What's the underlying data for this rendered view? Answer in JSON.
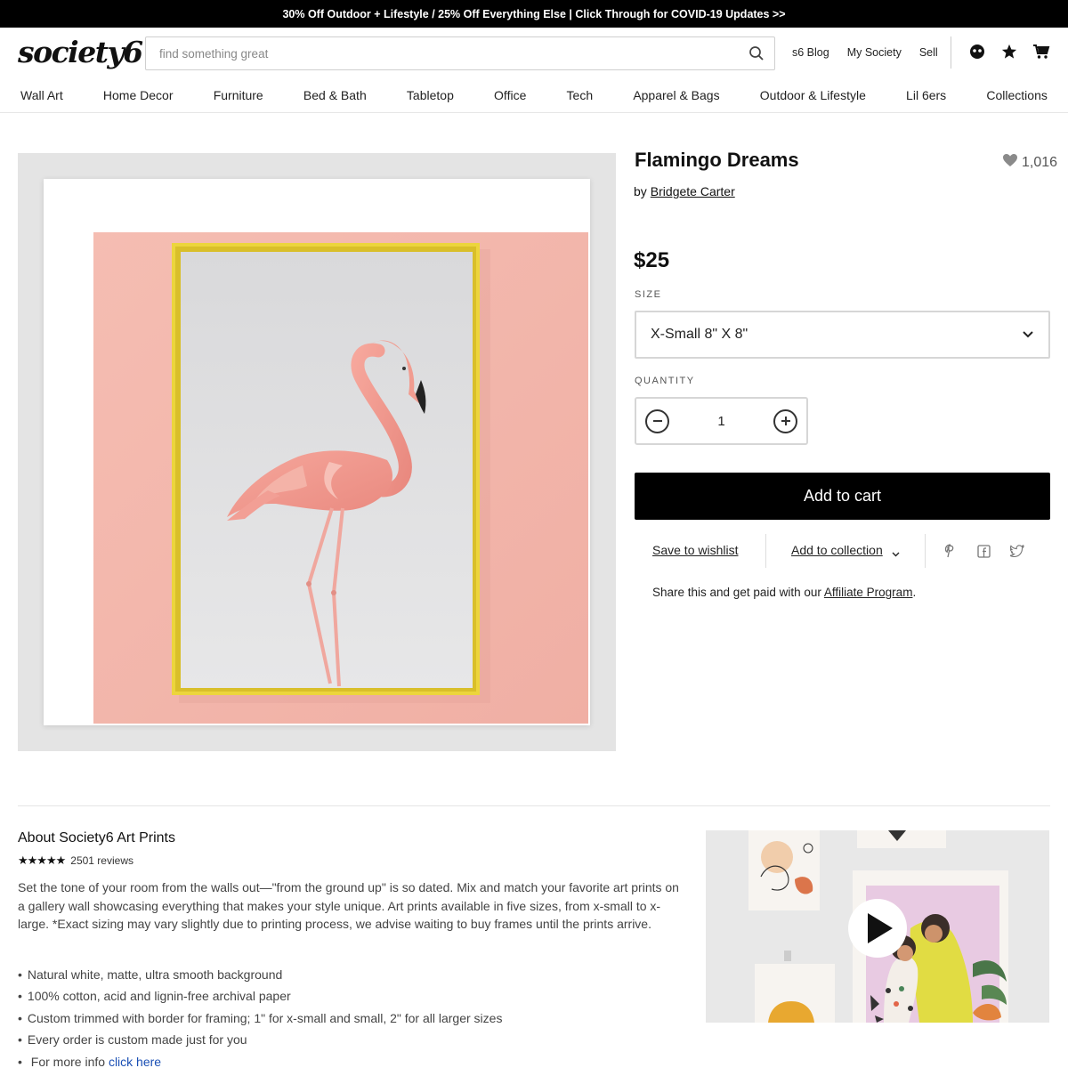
{
  "promo_banner": "30% Off Outdoor + Lifestyle / 25% Off Everything Else | Click Through for COVID-19 Updates >>",
  "header": {
    "logo": "society6",
    "search_placeholder": "find something great",
    "links": [
      "s6 Blog",
      "My Society",
      "Sell"
    ],
    "icons": [
      "account-icon",
      "star-icon",
      "cart-icon"
    ]
  },
  "nav": [
    "Wall Art",
    "Home Decor",
    "Furniture",
    "Bed & Bath",
    "Tabletop",
    "Office",
    "Tech",
    "Apparel & Bags",
    "Outdoor & Lifestyle",
    "Lil 6ers",
    "Collections"
  ],
  "product": {
    "title": "Flamingo Dreams",
    "by": "by",
    "artist": "Bridgete Carter",
    "likes": "1,016",
    "price": "$25",
    "size_label": "SIZE",
    "size_value": "X-Small 8\" X 8\"",
    "quantity_label": "QUANTITY",
    "quantity": "1",
    "add_to_cart": "Add to cart",
    "save_to_wishlist": "Save to wishlist",
    "add_to_collection": "Add to collection",
    "share_icons": [
      "pinterest-icon",
      "facebook-icon",
      "twitter-icon"
    ],
    "affiliate_prefix": "Share this and get paid with our",
    "affiliate_link": "Affiliate Program",
    "affiliate_suffix": "."
  },
  "about": {
    "title": "About Society6 Art Prints",
    "stars": "★★★★★",
    "reviews": "2501 reviews",
    "description": "Set the tone of your room from the walls out—\"from the ground up\" is so dated. Mix and match your favorite art prints on a gallery wall showcasing everything that makes your style unique. Art prints available in five sizes, from x-small to x-large. *Exact sizing may vary slightly due to printing process, we advise waiting to buy frames until the prints arrive.",
    "bullets": [
      "Natural white, matte, ultra smooth background",
      "100% cotton, acid and lignin-free archival paper",
      "Custom trimmed with border for framing; 1\" for x-small and small, 2\" for all larger sizes",
      "Every order is custom made just for you"
    ],
    "more_prefix": "For more info",
    "more_link": "click here"
  },
  "colors": {
    "wall_pink": "#f3b8ad",
    "frame_gold": "#e8d23a",
    "flamingo": "#ee8f86",
    "button_black": "#000000",
    "link_blue": "#1a4fb4"
  }
}
